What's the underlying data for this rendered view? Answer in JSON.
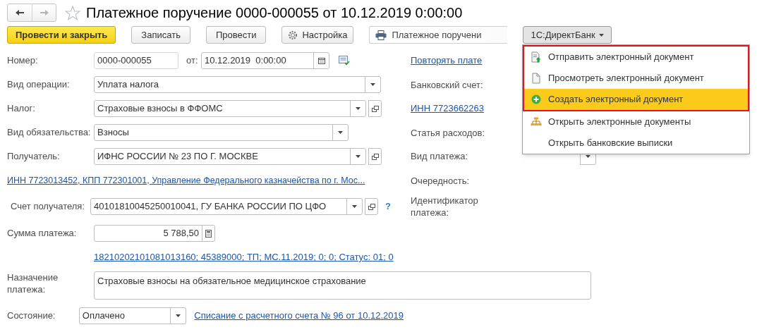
{
  "nav": [
    {
      "kind": "back",
      "disabled": false
    },
    {
      "kind": "forward",
      "disabled": true
    }
  ],
  "header": {
    "title": "Платежное поручение 0000-000055 от 10.12.2019 0:00:00",
    "favorite": false
  },
  "toolbar": [
    {
      "label": "Провести и закрыть",
      "kind": "primary"
    },
    {
      "label": "Записать",
      "kind": "plain"
    },
    {
      "label": "Провести",
      "kind": "plain"
    },
    {
      "label": "Настройка",
      "kind": "gear"
    },
    {
      "label": "Платежное поручени",
      "kind": "print"
    },
    {
      "label": "1С:ДиректБанк",
      "kind": "menu",
      "expanded": true
    }
  ],
  "form": {
    "number": {
      "label": "Номер:",
      "value": "0000-000055"
    },
    "date": {
      "label": "от:",
      "value": "10.12.2019  0:00:00"
    },
    "operation": {
      "label": "Вид операции:",
      "value": "Уплата налога"
    },
    "tax": {
      "label": "Налог:",
      "value": "Страховые взносы в ФФОМС"
    },
    "obligation": {
      "label": "Вид обязательства:",
      "value": "Взносы"
    },
    "recipient": {
      "label": "Получатель:",
      "value": "ИФНС РОССИИ № 23 ПО Г. МОСКВЕ"
    },
    "recipient_link": "ИНН 7723013452, КПП 772301001, Управление Федерального казначейства по г. Мос...",
    "account": {
      "label": "Счет получателя:",
      "value": "40101810045250010041, ГУ БАНКА РОССИИ ПО ЦФО",
      "help": "?"
    },
    "amount": {
      "label": "Сумма платежа:",
      "value": "5 788,50"
    },
    "kbk_link": "18210202101081013160; 45389000; ТП; МС.11.2019; 0; 0; Статус: 01; 0",
    "purpose": {
      "label": "Назначение платежа:",
      "value": "Страховые взносы на обязательное медицинское страхование"
    },
    "state": {
      "label": "Состояние:",
      "value": "Оплачено",
      "link": "Списание с расчетного счета № 96 от 10.12.2019"
    }
  },
  "right_column": [
    {
      "kind": "link",
      "text": "Повторять плате"
    },
    {
      "kind": "label",
      "text": "Банковский счет:"
    },
    {
      "kind": "link",
      "text": "ИНН 7723662263"
    },
    {
      "kind": "label",
      "text": "Статья расходов:"
    },
    {
      "kind": "select",
      "text": "Вид платежа:"
    },
    {
      "kind": "label",
      "text": "Очередность:"
    },
    {
      "kind": "label",
      "text": "Идентификатор платежа:"
    }
  ],
  "menu": {
    "items": [
      {
        "label": "Отправить электронный документ",
        "kind": "send",
        "selected": false,
        "outlined": true
      },
      {
        "label": "Просмотреть электронный документ",
        "kind": "view",
        "selected": false,
        "outlined": true
      },
      {
        "label": "Создать электронный документ",
        "kind": "create",
        "selected": true,
        "outlined": true
      },
      {
        "label": "Открыть электронные документы",
        "kind": "tree",
        "selected": false,
        "outlined": false
      },
      {
        "label": "Открыть банковские выписки",
        "kind": "plain",
        "selected": false,
        "outlined": false
      }
    ]
  }
}
